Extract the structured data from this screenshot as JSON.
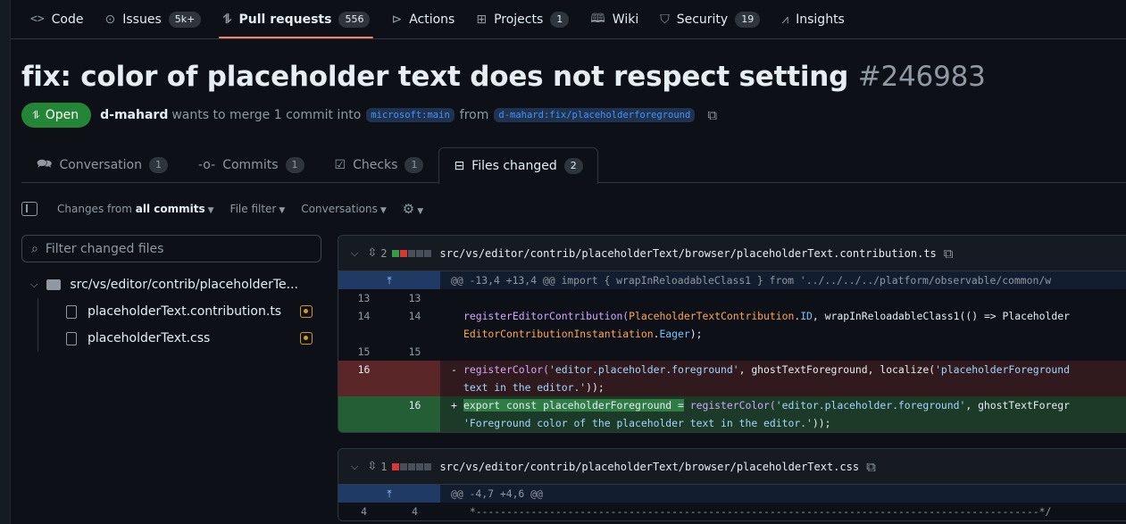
{
  "repo_nav": [
    {
      "label": "Code",
      "icon": "code-icon",
      "glyph": "<>",
      "count": ""
    },
    {
      "label": "Issues",
      "icon": "issue-icon",
      "glyph": "⊙",
      "count": "5k+"
    },
    {
      "label": "Pull requests",
      "icon": "pull-request-icon",
      "glyph": "⥮",
      "count": "556"
    },
    {
      "label": "Actions",
      "icon": "play-icon",
      "glyph": "⊳",
      "count": ""
    },
    {
      "label": "Projects",
      "icon": "table-icon",
      "glyph": "⊞",
      "count": "1"
    },
    {
      "label": "Wiki",
      "icon": "book-icon",
      "glyph": "🕮",
      "count": ""
    },
    {
      "label": "Security",
      "icon": "shield-icon",
      "glyph": "⛉",
      "count": "19"
    },
    {
      "label": "Insights",
      "icon": "graph-icon",
      "glyph": "⩘",
      "count": ""
    }
  ],
  "pr": {
    "title": "fix: color of placeholder text does not respect setting",
    "number": "#246983",
    "state": "Open",
    "author": "d-mahard",
    "merge_text": "wants to merge 1 commit into",
    "base_branch": "microsoft:main",
    "from_text": "from",
    "head_branch": "d-mahard:fix/placeholderforeground"
  },
  "pr_tabs": [
    {
      "label": "Conversation",
      "count": "1",
      "glyph": "🗪",
      "icon": "comment-discussion-icon"
    },
    {
      "label": "Commits",
      "count": "1",
      "glyph": "-o-",
      "icon": "commit-icon"
    },
    {
      "label": "Checks",
      "count": "1",
      "glyph": "☑",
      "icon": "checklist-icon"
    },
    {
      "label": "Files changed",
      "count": "2",
      "glyph": "⊟",
      "icon": "file-diff-icon"
    }
  ],
  "toolbar": {
    "changes_prefix": "Changes from",
    "changes_value": "all commits",
    "file_filter": "File filter",
    "conversations": "Conversations"
  },
  "filter": {
    "placeholder": "Filter changed files"
  },
  "tree": {
    "folder": "src/vs/editor/contrib/placeholderTe...",
    "files": [
      "placeholderText.contribution.ts",
      "placeholderText.css"
    ]
  },
  "diff1": {
    "changes": "2",
    "path": "src/vs/editor/contrib/placeholderText/browser/placeholderText.contribution.ts",
    "hunk": "@@ -13,4 +13,4 @@ import { wrapInReloadableClass1 } from '../../../../platform/observable/common/w",
    "ln13": "13",
    "ln14": "14",
    "ln15": "15",
    "ln16": "16",
    "l14_a": "registerEditorContribution(",
    "l14_b": "PlaceholderTextContribution",
    "l14_c": ".",
    "l14_d": "ID",
    "l14_e": ", wrapInReloadableClass1(() => Placeholder",
    "l14_f": "EditorContributionInstantiation",
    "l14_g": ".",
    "l14_h": "Eager",
    "l14_i": ");",
    "del_sign": "-",
    "del_a": "registerColor(",
    "del_b": "'editor.placeholder.foreground'",
    "del_c": ", ghostTextForeground, localize(",
    "del_d": "'placeholderForeground",
    "del_e": "text in the editor.'",
    "del_f": "));",
    "add_sign": "+",
    "add_a": "export const placeholderForeground =",
    "add_b": " registerColor(",
    "add_c": "'editor.placeholder.foreground'",
    "add_d": ", ghostTextForegr",
    "add_e": "'Foreground color of the placeholder text in the editor.'",
    "add_f": "));"
  },
  "diff2": {
    "changes": "1",
    "path": "src/vs/editor/contrib/placeholderText/browser/placeholderText.css",
    "hunk": "@@ -4,7 +4,6 @@",
    "ln4": "4",
    "l4": " *--------------------------------------------------------------------------------------------*/"
  }
}
